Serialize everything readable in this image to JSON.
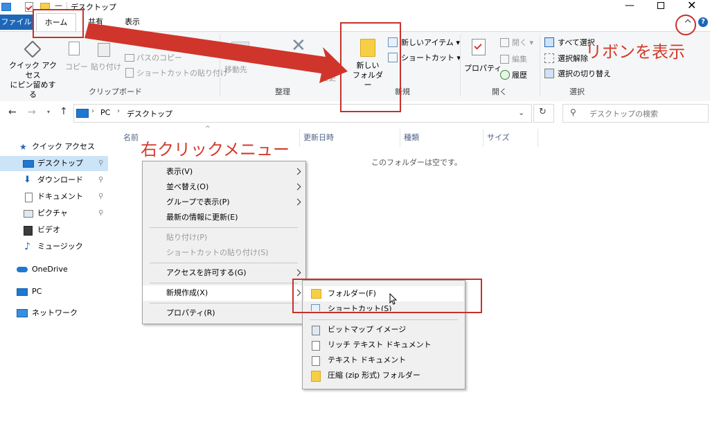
{
  "window": {
    "title": "デスクトップ"
  },
  "ribbon": {
    "tabs": {
      "file": "ファイル",
      "home": "ホーム",
      "share": "共有",
      "view": "表示"
    },
    "clipboard": {
      "pin_label": "クイック アクセス\nにピン留めする",
      "copy": "コピー",
      "paste": "貼り付け",
      "copy_path": "パスのコピー",
      "paste_shortcut": "ショートカットの貼り付け",
      "group": "クリップボード"
    },
    "organize": {
      "move_to": "移動先",
      "copy_to": "変更",
      "group": "整理"
    },
    "new": {
      "new_folder": "新しい\nフォルダー",
      "new_item": "新しいアイテム ▾",
      "shortcut": "ショートカット ▾",
      "group": "新規"
    },
    "open": {
      "properties": "プロパティ",
      "open": "開く ▾",
      "edit": "編集",
      "history": "履歴",
      "group": "開く"
    },
    "select": {
      "select_all": "すべて選択",
      "select_none": "選択解除",
      "invert": "選択の切り替え",
      "group": "選択"
    }
  },
  "address": {
    "path": [
      "PC",
      "デスクトップ"
    ],
    "search_placeholder": "デスクトップの検索"
  },
  "nav": {
    "quick_access": "クイック アクセス",
    "desktop": "デスクトップ",
    "downloads": "ダウンロード",
    "documents": "ドキュメント",
    "pictures": "ピクチャ",
    "videos": "ビデオ",
    "music": "ミュージック",
    "onedrive": "OneDrive",
    "pc": "PC",
    "network": "ネットワーク"
  },
  "content": {
    "columns": {
      "name": "名前",
      "modified": "更新日時",
      "type": "種類",
      "size": "サイズ"
    },
    "empty_message": "このフォルダーは空です。"
  },
  "context_menu": {
    "view": "表示(V)",
    "sort": "並べ替え(O)",
    "group_by": "グループで表示(P)",
    "refresh": "最新の情報に更新(E)",
    "paste": "貼り付け(P)",
    "paste_shortcut": "ショートカットの貼り付け(S)",
    "give_access": "アクセスを許可する(G)",
    "new": "新規作成(X)",
    "properties": "プロパティ(R)"
  },
  "submenu": {
    "folder": "フォルダー(F)",
    "shortcut": "ショートカット(S)",
    "bitmap": "ビットマップ イメージ",
    "rtf": "リッチ テキスト ドキュメント",
    "text": "テキスト ドキュメント",
    "zip": "圧縮 (zip 形式) フォルダー"
  },
  "annotations": {
    "show_ribbon": "リボンを表示",
    "right_click_menu": "右クリックメニュー"
  },
  "colors": {
    "annotation_red": "#c7302a",
    "file_tab_blue": "#1e66b8",
    "selection": "#cce4f7"
  }
}
